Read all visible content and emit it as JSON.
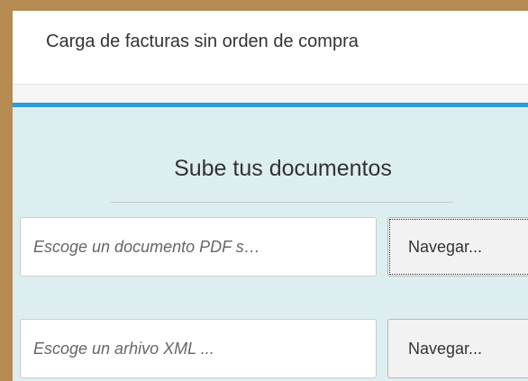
{
  "header": {
    "title": "Carga de facturas sin orden de compra"
  },
  "upload_panel": {
    "heading": "Sube tus documentos",
    "pdf_field": {
      "placeholder": "Escoge un documento PDF s…",
      "button_label": "Navegar..."
    },
    "xml_field": {
      "placeholder": "Escoge un arhivo XML ...",
      "button_label": "Navegar..."
    }
  },
  "colors": {
    "frame_border": "#b58b52",
    "panel_background": "#ddeef0",
    "accent_bar": "#2d9cdb",
    "header_background": "#ffffff"
  }
}
